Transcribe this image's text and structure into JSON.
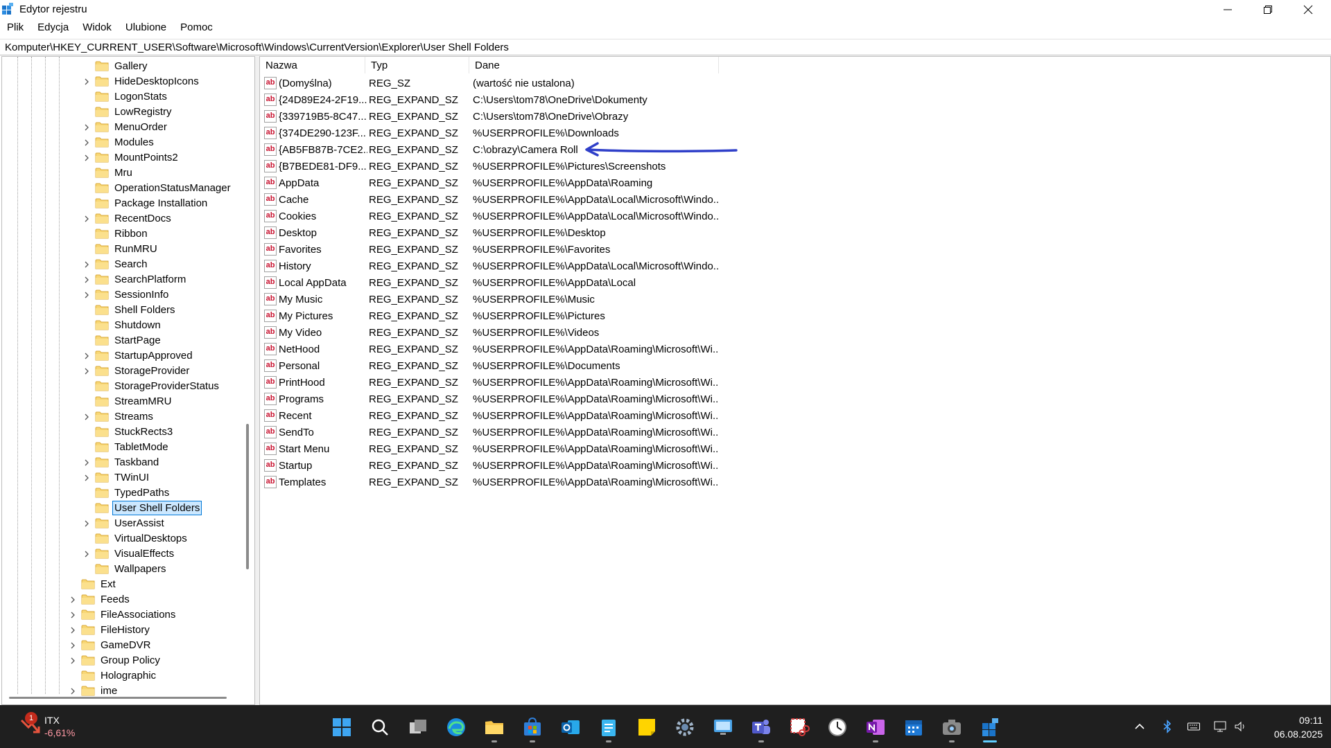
{
  "window": {
    "title": "Edytor rejestru"
  },
  "menu": [
    "Plik",
    "Edycja",
    "Widok",
    "Ulubione",
    "Pomoc"
  ],
  "address": "Komputer\\HKEY_CURRENT_USER\\Software\\Microsoft\\Windows\\CurrentVersion\\Explorer\\User Shell Folders",
  "tree": [
    {
      "label": "Gallery",
      "level": 2,
      "expandable": false
    },
    {
      "label": "HideDesktopIcons",
      "level": 2,
      "expandable": true
    },
    {
      "label": "LogonStats",
      "level": 2,
      "expandable": false
    },
    {
      "label": "LowRegistry",
      "level": 2,
      "expandable": false
    },
    {
      "label": "MenuOrder",
      "level": 2,
      "expandable": true
    },
    {
      "label": "Modules",
      "level": 2,
      "expandable": true
    },
    {
      "label": "MountPoints2",
      "level": 2,
      "expandable": true
    },
    {
      "label": "Mru",
      "level": 2,
      "expandable": false
    },
    {
      "label": "OperationStatusManager",
      "level": 2,
      "expandable": false
    },
    {
      "label": "Package Installation",
      "level": 2,
      "expandable": false
    },
    {
      "label": "RecentDocs",
      "level": 2,
      "expandable": true
    },
    {
      "label": "Ribbon",
      "level": 2,
      "expandable": false
    },
    {
      "label": "RunMRU",
      "level": 2,
      "expandable": false
    },
    {
      "label": "Search",
      "level": 2,
      "expandable": true
    },
    {
      "label": "SearchPlatform",
      "level": 2,
      "expandable": true
    },
    {
      "label": "SessionInfo",
      "level": 2,
      "expandable": true
    },
    {
      "label": "Shell Folders",
      "level": 2,
      "expandable": false
    },
    {
      "label": "Shutdown",
      "level": 2,
      "expandable": false
    },
    {
      "label": "StartPage",
      "level": 2,
      "expandable": false
    },
    {
      "label": "StartupApproved",
      "level": 2,
      "expandable": true
    },
    {
      "label": "StorageProvider",
      "level": 2,
      "expandable": true
    },
    {
      "label": "StorageProviderStatus",
      "level": 2,
      "expandable": false
    },
    {
      "label": "StreamMRU",
      "level": 2,
      "expandable": false
    },
    {
      "label": "Streams",
      "level": 2,
      "expandable": true
    },
    {
      "label": "StuckRects3",
      "level": 2,
      "expandable": false
    },
    {
      "label": "TabletMode",
      "level": 2,
      "expandable": false
    },
    {
      "label": "Taskband",
      "level": 2,
      "expandable": true
    },
    {
      "label": "TWinUI",
      "level": 2,
      "expandable": true
    },
    {
      "label": "TypedPaths",
      "level": 2,
      "expandable": false
    },
    {
      "label": "User Shell Folders",
      "level": 2,
      "expandable": false,
      "selected": true
    },
    {
      "label": "UserAssist",
      "level": 2,
      "expandable": true
    },
    {
      "label": "VirtualDesktops",
      "level": 2,
      "expandable": false
    },
    {
      "label": "VisualEffects",
      "level": 2,
      "expandable": true
    },
    {
      "label": "Wallpapers",
      "level": 2,
      "expandable": false
    },
    {
      "label": "Ext",
      "level": 1,
      "expandable": false
    },
    {
      "label": "Feeds",
      "level": 1,
      "expandable": true
    },
    {
      "label": "FileAssociations",
      "level": 1,
      "expandable": true
    },
    {
      "label": "FileHistory",
      "level": 1,
      "expandable": true
    },
    {
      "label": "GameDVR",
      "level": 1,
      "expandable": true
    },
    {
      "label": "Group Policy",
      "level": 1,
      "expandable": true
    },
    {
      "label": "Holographic",
      "level": 1,
      "expandable": false
    },
    {
      "label": "ime",
      "level": 1,
      "expandable": true
    }
  ],
  "columns": {
    "name": "Nazwa",
    "type": "Typ",
    "data": "Dane"
  },
  "values": [
    {
      "name": "(Domyślna)",
      "type": "REG_SZ",
      "data": "(wartość nie ustalona)"
    },
    {
      "name": "{24D89E24-2F19...",
      "type": "REG_EXPAND_SZ",
      "data": "C:\\Users\\tom78\\OneDrive\\Dokumenty"
    },
    {
      "name": "{339719B5-8C47...",
      "type": "REG_EXPAND_SZ",
      "data": "C:\\Users\\tom78\\OneDrive\\Obrazy"
    },
    {
      "name": "{374DE290-123F...",
      "type": "REG_EXPAND_SZ",
      "data": "%USERPROFILE%\\Downloads"
    },
    {
      "name": "{AB5FB87B-7CE2...",
      "type": "REG_EXPAND_SZ",
      "data": "C:\\obrazy\\Camera Roll"
    },
    {
      "name": "{B7BEDE81-DF9...",
      "type": "REG_EXPAND_SZ",
      "data": "%USERPROFILE%\\Pictures\\Screenshots"
    },
    {
      "name": "AppData",
      "type": "REG_EXPAND_SZ",
      "data": "%USERPROFILE%\\AppData\\Roaming"
    },
    {
      "name": "Cache",
      "type": "REG_EXPAND_SZ",
      "data": "%USERPROFILE%\\AppData\\Local\\Microsoft\\Windo..."
    },
    {
      "name": "Cookies",
      "type": "REG_EXPAND_SZ",
      "data": "%USERPROFILE%\\AppData\\Local\\Microsoft\\Windo..."
    },
    {
      "name": "Desktop",
      "type": "REG_EXPAND_SZ",
      "data": "%USERPROFILE%\\Desktop"
    },
    {
      "name": "Favorites",
      "type": "REG_EXPAND_SZ",
      "data": "%USERPROFILE%\\Favorites"
    },
    {
      "name": "History",
      "type": "REG_EXPAND_SZ",
      "data": "%USERPROFILE%\\AppData\\Local\\Microsoft\\Windo..."
    },
    {
      "name": "Local AppData",
      "type": "REG_EXPAND_SZ",
      "data": "%USERPROFILE%\\AppData\\Local"
    },
    {
      "name": "My Music",
      "type": "REG_EXPAND_SZ",
      "data": "%USERPROFILE%\\Music"
    },
    {
      "name": "My Pictures",
      "type": "REG_EXPAND_SZ",
      "data": "%USERPROFILE%\\Pictures"
    },
    {
      "name": "My Video",
      "type": "REG_EXPAND_SZ",
      "data": "%USERPROFILE%\\Videos"
    },
    {
      "name": "NetHood",
      "type": "REG_EXPAND_SZ",
      "data": "%USERPROFILE%\\AppData\\Roaming\\Microsoft\\Wi..."
    },
    {
      "name": "Personal",
      "type": "REG_EXPAND_SZ",
      "data": "%USERPROFILE%\\Documents"
    },
    {
      "name": "PrintHood",
      "type": "REG_EXPAND_SZ",
      "data": "%USERPROFILE%\\AppData\\Roaming\\Microsoft\\Wi..."
    },
    {
      "name": "Programs",
      "type": "REG_EXPAND_SZ",
      "data": "%USERPROFILE%\\AppData\\Roaming\\Microsoft\\Wi..."
    },
    {
      "name": "Recent",
      "type": "REG_EXPAND_SZ",
      "data": "%USERPROFILE%\\AppData\\Roaming\\Microsoft\\Wi..."
    },
    {
      "name": "SendTo",
      "type": "REG_EXPAND_SZ",
      "data": "%USERPROFILE%\\AppData\\Roaming\\Microsoft\\Wi..."
    },
    {
      "name": "Start Menu",
      "type": "REG_EXPAND_SZ",
      "data": "%USERPROFILE%\\AppData\\Roaming\\Microsoft\\Wi..."
    },
    {
      "name": "Startup",
      "type": "REG_EXPAND_SZ",
      "data": "%USERPROFILE%\\AppData\\Roaming\\Microsoft\\Wi..."
    },
    {
      "name": "Templates",
      "type": "REG_EXPAND_SZ",
      "data": "%USERPROFILE%\\AppData\\Roaming\\Microsoft\\Wi..."
    }
  ],
  "taskbar": {
    "stock": {
      "name": "ITX",
      "change": "-6,61%",
      "badge": "1"
    },
    "apps": [
      "start-icon",
      "search-icon",
      "task-view-icon",
      "edge-icon",
      "file-explorer-icon",
      "store-icon",
      "outlook-icon",
      "notepad-icon",
      "sticky-notes-icon",
      "settings-icon",
      "remote-desktop-icon",
      "teams-icon",
      "snipping-tool-icon",
      "clock-icon",
      "onenote-icon",
      "calendar-icon",
      "camera-icon",
      "registry-editor-icon"
    ],
    "time": "09:11",
    "date": "06.08.2025"
  },
  "colors": {
    "accent": "#0078d7",
    "selection": "#cce8ff",
    "folder": "#f8d775",
    "taskbar": "#1f1f1f",
    "annotation": "#2f3fc9"
  }
}
